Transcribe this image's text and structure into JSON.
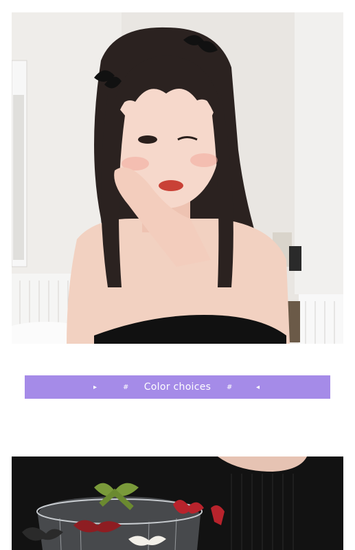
{
  "banner": {
    "title": "Color choices",
    "left_arrow": "▸",
    "left_hash": "#",
    "right_hash": "#",
    "right_arrow": "◂",
    "color": "#a58be8"
  },
  "photos": {
    "top": {
      "subject": "model-with-bow-claw-clips"
    },
    "bottom": {
      "subject": "bow-claw-clips-in-glass-bowl"
    }
  }
}
